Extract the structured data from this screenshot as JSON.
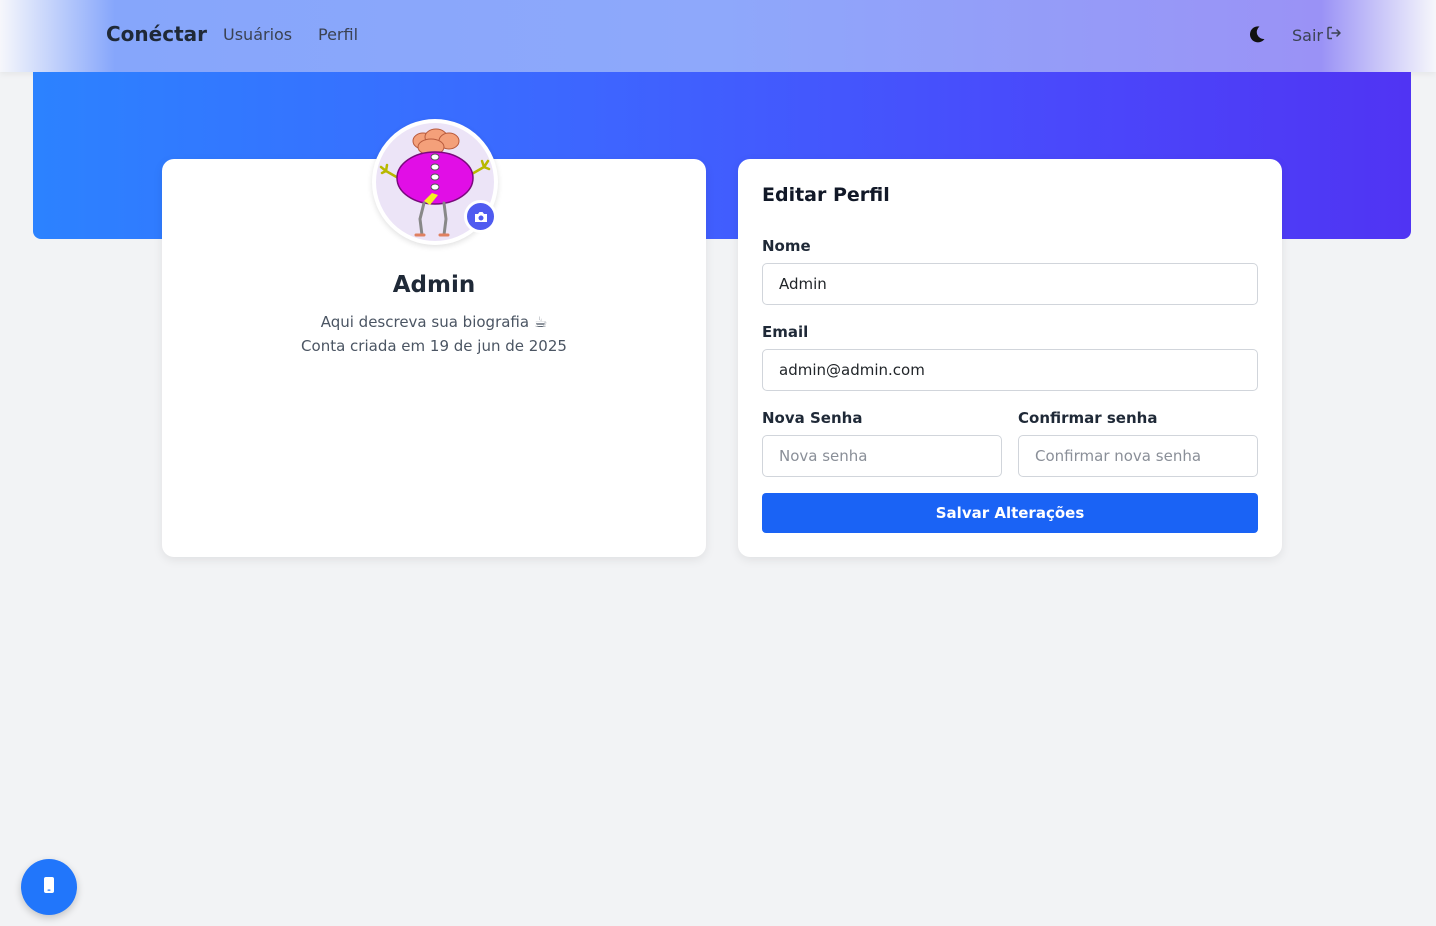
{
  "navbar": {
    "brand": "Conéctar",
    "links": [
      {
        "label": "Usuários"
      },
      {
        "label": "Perfil"
      }
    ],
    "theme_toggle_icon": "moon-icon",
    "logout_label": "Sair",
    "logout_icon": "logout-icon"
  },
  "colors": {
    "primary": "#1a63f5",
    "hero_start": "#2c82ff",
    "hero_end": "#5034f3",
    "camera_button": "#4f5bf0",
    "page_bg": "#f2f3f5"
  },
  "profile": {
    "name": "Admin",
    "bio": "Aqui descreva sua biografia ☕",
    "created": "Conta criada em 19 de jun de 2025",
    "avatar_icon": "avatar-illustration",
    "camera_icon": "camera-icon"
  },
  "form": {
    "title": "Editar Perfil",
    "name_label": "Nome",
    "name_value": "Admin",
    "email_label": "Email",
    "email_value": "admin@admin.com",
    "new_password_label": "Nova Senha",
    "new_password_placeholder": "Nova senha",
    "confirm_password_label": "Confirmar senha",
    "confirm_password_placeholder": "Confirmar nova senha",
    "save_label": "Salvar Alterações"
  },
  "floating_button": {
    "icon": "mobile-phone-icon"
  }
}
